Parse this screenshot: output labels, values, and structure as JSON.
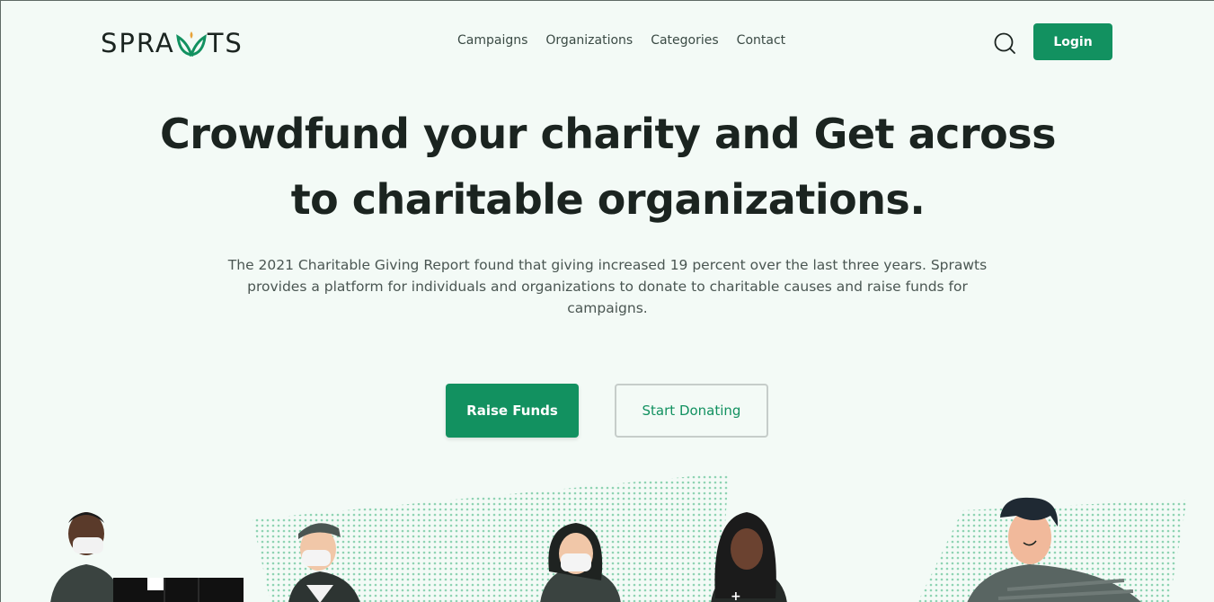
{
  "brand": {
    "name_left": "SPRA",
    "name_right": "TS",
    "accent": "#129160"
  },
  "nav": {
    "links": [
      "Campaigns",
      "Organizations",
      "Categories",
      "Contact"
    ],
    "search_icon": "search-icon",
    "login_label": "Login"
  },
  "hero": {
    "headline_line1": "Crowdfund your charity and Get across",
    "headline_line2": "to charitable organizations.",
    "description": "The 2021 Charitable Giving Report found that giving increased 19 percent over the last three years. Sprawts provides a platform for individuals and organizations to donate to charitable causes and raise funds for campaigns.",
    "primary_cta": "Raise Funds",
    "secondary_cta": "Start Donating"
  },
  "colors": {
    "primary": "#129160",
    "background": "#f3faf6",
    "text": "#1b2420"
  }
}
